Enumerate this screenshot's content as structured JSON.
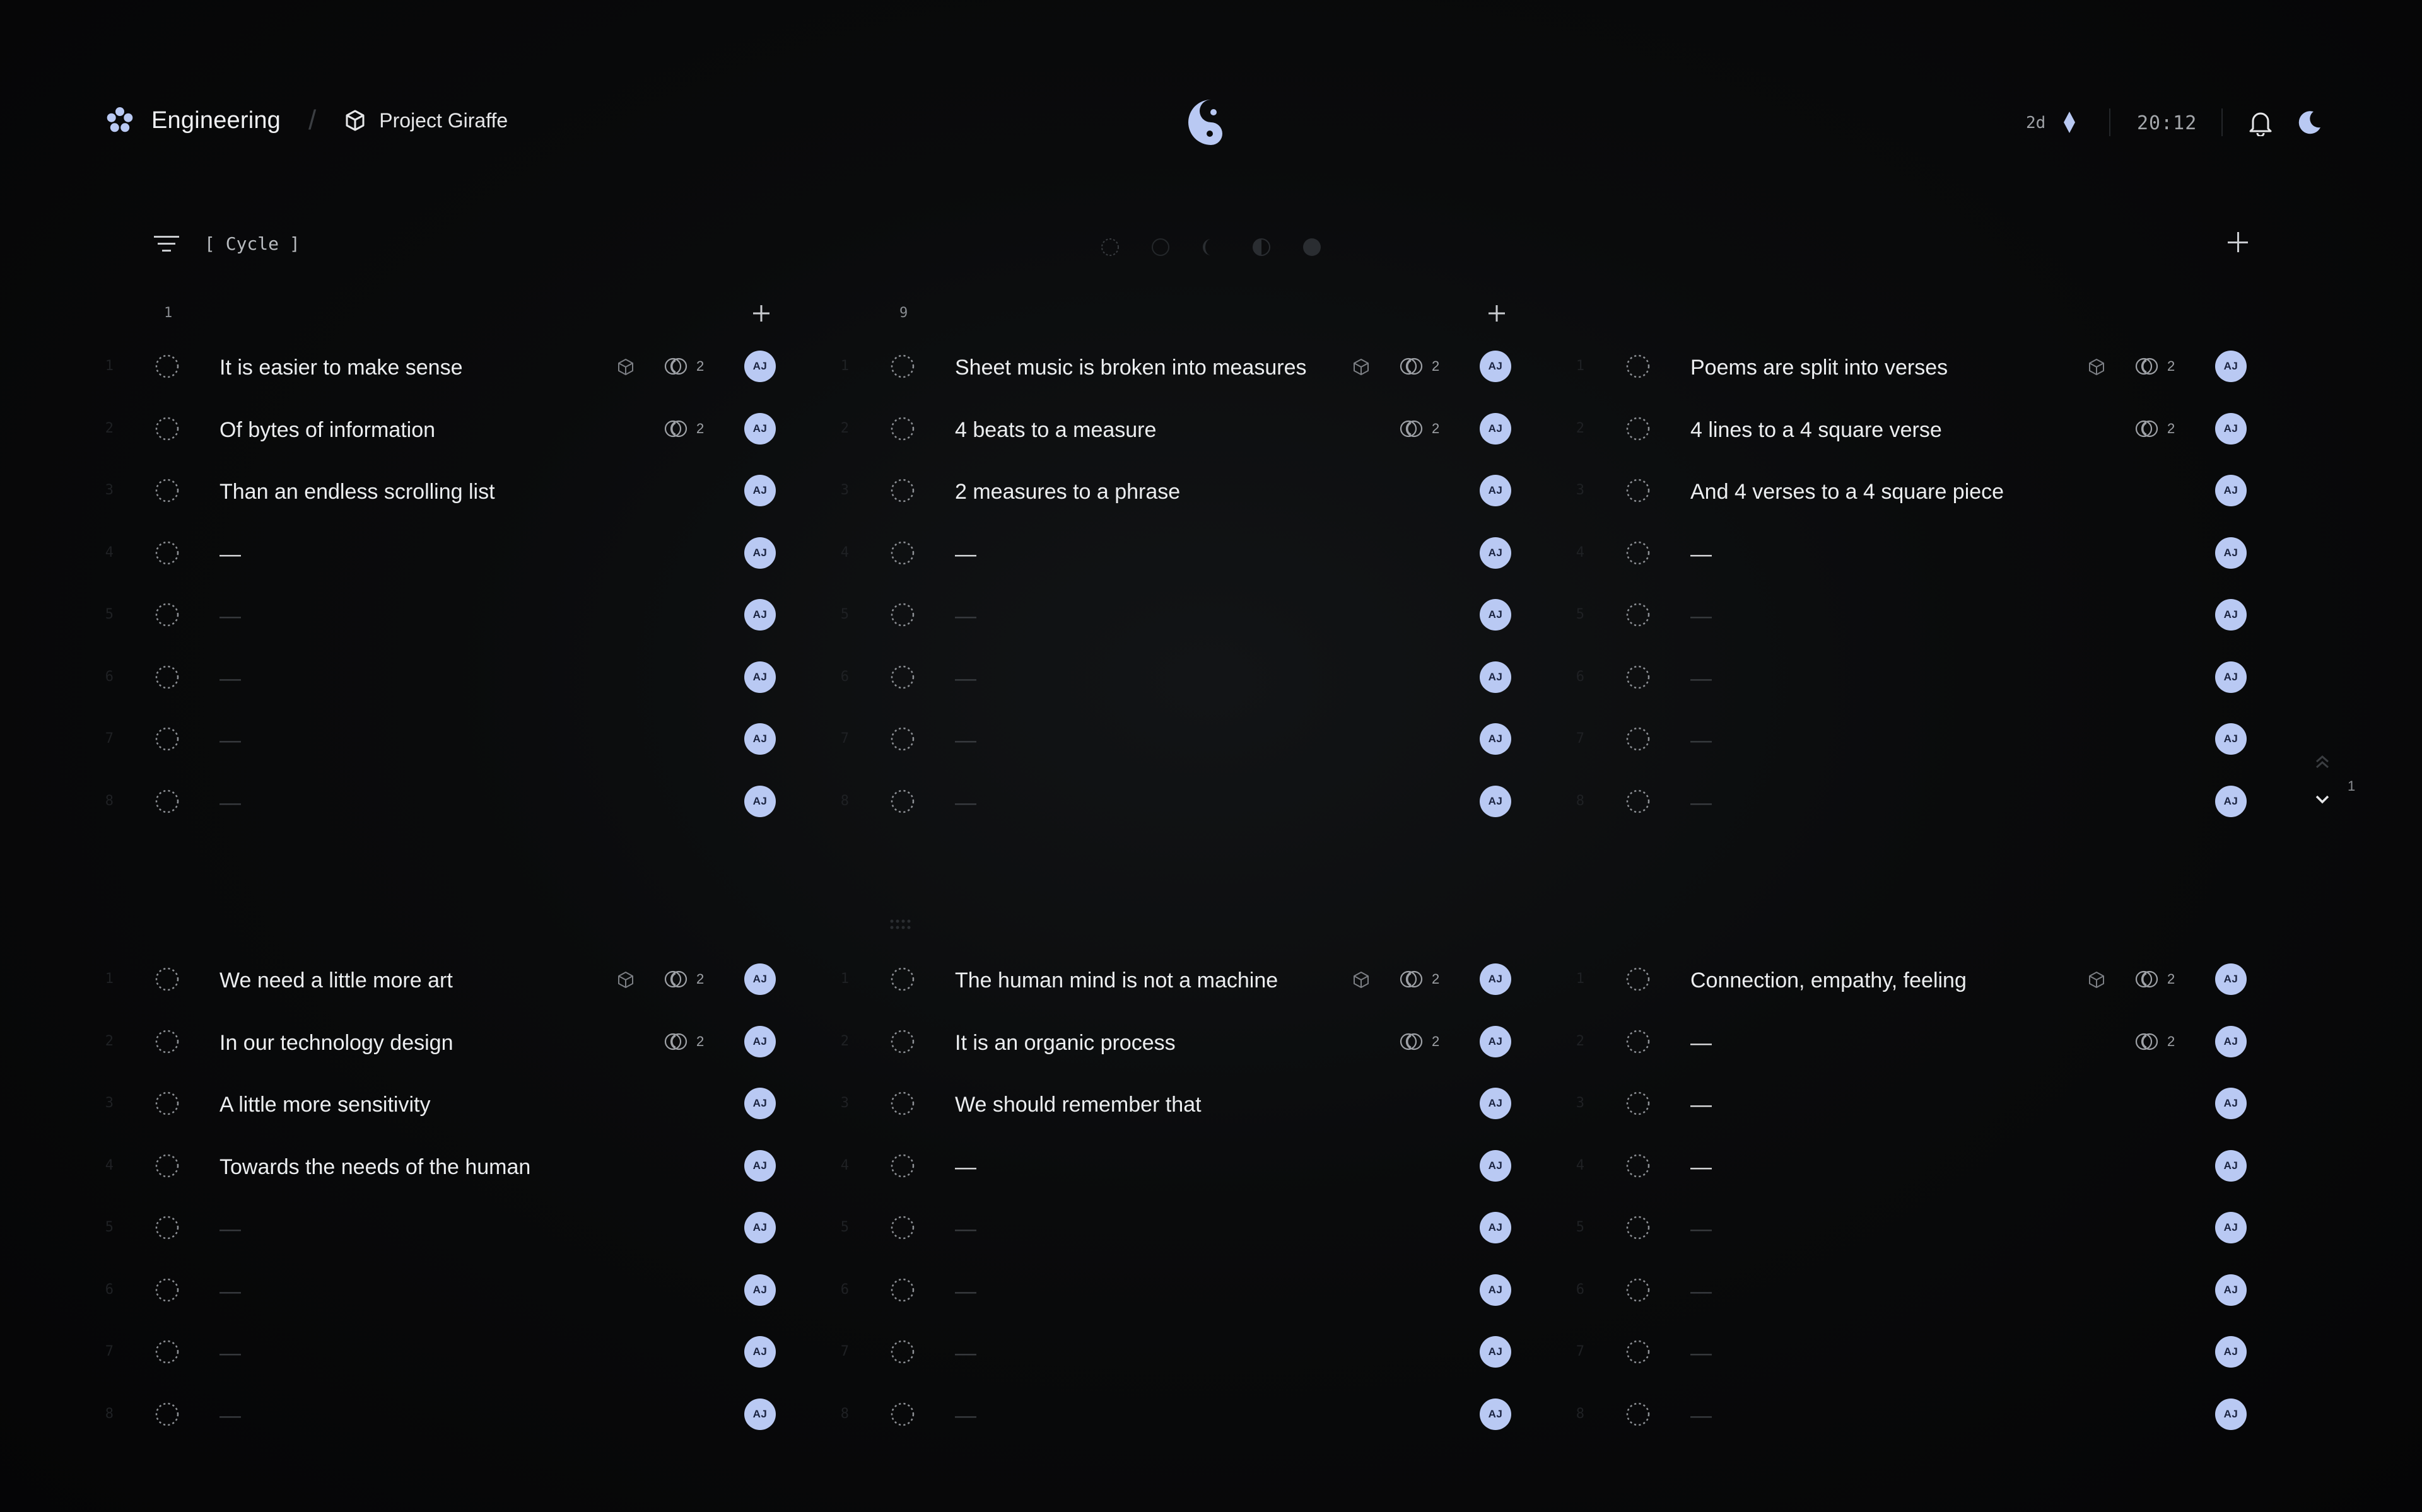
{
  "header": {
    "workspace": "Engineering",
    "separator": "/",
    "project": "Project Giraffe",
    "age": "2d",
    "time": "20:12"
  },
  "toolbar": {
    "cycle_label": "[ Cycle ]"
  },
  "colors": {
    "accent": "#b9c9f3",
    "background": "#0a0b0c",
    "text": "#eceef0"
  },
  "icons": [
    "workspace-flower-icon",
    "cube-icon",
    "yin-yang-logo-icon",
    "diamond-icon",
    "bell-icon",
    "moon-icon",
    "filter-icon",
    "plus-icon",
    "status-circle-icon",
    "comment-icon",
    "chevron-up-icon",
    "chevron-down-icon",
    "grip-icon"
  ],
  "board": {
    "groups": [
      {
        "labels": [
          "1",
          "9"
        ],
        "columns": [
          {
            "rows": [
              {
                "index": "1",
                "title": "It is easier to make sense",
                "style": "text",
                "cube": true,
                "comments": "2",
                "assignee": "AJ"
              },
              {
                "index": "2",
                "title": "Of bytes of information",
                "style": "text",
                "cube": false,
                "comments": "2",
                "assignee": "AJ"
              },
              {
                "index": "3",
                "title": "Than an endless scrolling list",
                "style": "text",
                "cube": false,
                "comments": "",
                "assignee": "AJ"
              },
              {
                "index": "4",
                "title": "—",
                "style": "dash",
                "cube": false,
                "comments": "",
                "assignee": "AJ"
              },
              {
                "index": "5",
                "title": "—",
                "style": "faint",
                "cube": false,
                "comments": "",
                "assignee": "AJ"
              },
              {
                "index": "6",
                "title": "—",
                "style": "faint",
                "cube": false,
                "comments": "",
                "assignee": "AJ"
              },
              {
                "index": "7",
                "title": "—",
                "style": "faint",
                "cube": false,
                "comments": "",
                "assignee": "AJ"
              },
              {
                "index": "8",
                "title": "—",
                "style": "faint",
                "cube": false,
                "comments": "",
                "assignee": "AJ"
              }
            ]
          },
          {
            "rows": [
              {
                "index": "1",
                "title": "Sheet music is broken into measures",
                "style": "text",
                "cube": true,
                "comments": "2",
                "assignee": "AJ"
              },
              {
                "index": "2",
                "title": "4 beats to a measure",
                "style": "text",
                "cube": false,
                "comments": "2",
                "assignee": "AJ"
              },
              {
                "index": "3",
                "title": "2 measures to a phrase",
                "style": "text",
                "cube": false,
                "comments": "",
                "assignee": "AJ"
              },
              {
                "index": "4",
                "title": "—",
                "style": "dash",
                "cube": false,
                "comments": "",
                "assignee": "AJ"
              },
              {
                "index": "5",
                "title": "—",
                "style": "faint",
                "cube": false,
                "comments": "",
                "assignee": "AJ"
              },
              {
                "index": "6",
                "title": "—",
                "style": "faint",
                "cube": false,
                "comments": "",
                "assignee": "AJ"
              },
              {
                "index": "7",
                "title": "—",
                "style": "faint",
                "cube": false,
                "comments": "",
                "assignee": "AJ"
              },
              {
                "index": "8",
                "title": "—",
                "style": "faint",
                "cube": false,
                "comments": "",
                "assignee": "AJ"
              }
            ]
          },
          {
            "rows": [
              {
                "index": "1",
                "title": "Poems are split into verses",
                "style": "text",
                "cube": true,
                "comments": "2",
                "assignee": "AJ"
              },
              {
                "index": "2",
                "title": "4 lines to a 4 square verse",
                "style": "text",
                "cube": false,
                "comments": "2",
                "assignee": "AJ"
              },
              {
                "index": "3",
                "title": "And 4 verses to a 4 square piece",
                "style": "text",
                "cube": false,
                "comments": "",
                "assignee": "AJ"
              },
              {
                "index": "4",
                "title": "—",
                "style": "dash",
                "cube": false,
                "comments": "",
                "assignee": "AJ"
              },
              {
                "index": "5",
                "title": "—",
                "style": "faint",
                "cube": false,
                "comments": "",
                "assignee": "AJ"
              },
              {
                "index": "6",
                "title": "—",
                "style": "faint",
                "cube": false,
                "comments": "",
                "assignee": "AJ"
              },
              {
                "index": "7",
                "title": "—",
                "style": "faint",
                "cube": false,
                "comments": "",
                "assignee": "AJ"
              },
              {
                "index": "8",
                "title": "—",
                "style": "faint",
                "cube": false,
                "comments": "",
                "assignee": "AJ"
              }
            ]
          }
        ]
      },
      {
        "labels": [],
        "columns": [
          {
            "rows": [
              {
                "index": "1",
                "title": "We need a little more art",
                "style": "text",
                "cube": true,
                "comments": "2",
                "assignee": "AJ"
              },
              {
                "index": "2",
                "title": "In our technology design",
                "style": "text",
                "cube": false,
                "comments": "2",
                "assignee": "AJ"
              },
              {
                "index": "3",
                "title": "A little more sensitivity",
                "style": "text",
                "cube": false,
                "comments": "",
                "assignee": "AJ"
              },
              {
                "index": "4",
                "title": "Towards the needs of the human",
                "style": "text",
                "cube": false,
                "comments": "",
                "assignee": "AJ"
              },
              {
                "index": "5",
                "title": "—",
                "style": "faint",
                "cube": false,
                "comments": "",
                "assignee": "AJ"
              },
              {
                "index": "6",
                "title": "—",
                "style": "faint",
                "cube": false,
                "comments": "",
                "assignee": "AJ"
              },
              {
                "index": "7",
                "title": "—",
                "style": "faint",
                "cube": false,
                "comments": "",
                "assignee": "AJ"
              },
              {
                "index": "8",
                "title": "—",
                "style": "faint",
                "cube": false,
                "comments": "",
                "assignee": "AJ"
              }
            ]
          },
          {
            "rows": [
              {
                "index": "1",
                "title": "The human mind is not a machine",
                "style": "text",
                "cube": true,
                "comments": "2",
                "assignee": "AJ"
              },
              {
                "index": "2",
                "title": "It is an organic process",
                "style": "text",
                "cube": false,
                "comments": "2",
                "assignee": "AJ"
              },
              {
                "index": "3",
                "title": "We should remember that",
                "style": "text",
                "cube": false,
                "comments": "",
                "assignee": "AJ"
              },
              {
                "index": "4",
                "title": "—",
                "style": "dash",
                "cube": false,
                "comments": "",
                "assignee": "AJ"
              },
              {
                "index": "5",
                "title": "—",
                "style": "faint",
                "cube": false,
                "comments": "",
                "assignee": "AJ"
              },
              {
                "index": "6",
                "title": "—",
                "style": "faint",
                "cube": false,
                "comments": "",
                "assignee": "AJ"
              },
              {
                "index": "7",
                "title": "—",
                "style": "faint",
                "cube": false,
                "comments": "",
                "assignee": "AJ"
              },
              {
                "index": "8",
                "title": "—",
                "style": "faint",
                "cube": false,
                "comments": "",
                "assignee": "AJ"
              }
            ]
          },
          {
            "rows": [
              {
                "index": "1",
                "title": "Connection, empathy, feeling",
                "style": "text",
                "cube": true,
                "comments": "2",
                "assignee": "AJ"
              },
              {
                "index": "2",
                "title": "—",
                "style": "dash",
                "cube": false,
                "comments": "2",
                "assignee": "AJ"
              },
              {
                "index": "3",
                "title": "—",
                "style": "dash",
                "cube": false,
                "comments": "",
                "assignee": "AJ"
              },
              {
                "index": "4",
                "title": "—",
                "style": "dash",
                "cube": false,
                "comments": "",
                "assignee": "AJ"
              },
              {
                "index": "5",
                "title": "—",
                "style": "faint",
                "cube": false,
                "comments": "",
                "assignee": "AJ"
              },
              {
                "index": "6",
                "title": "—",
                "style": "faint",
                "cube": false,
                "comments": "",
                "assignee": "AJ"
              },
              {
                "index": "7",
                "title": "—",
                "style": "faint",
                "cube": false,
                "comments": "",
                "assignee": "AJ"
              },
              {
                "index": "8",
                "title": "—",
                "style": "faint",
                "cube": false,
                "comments": "",
                "assignee": "AJ"
              }
            ]
          }
        ]
      }
    ]
  },
  "pager": {
    "page": "1"
  }
}
